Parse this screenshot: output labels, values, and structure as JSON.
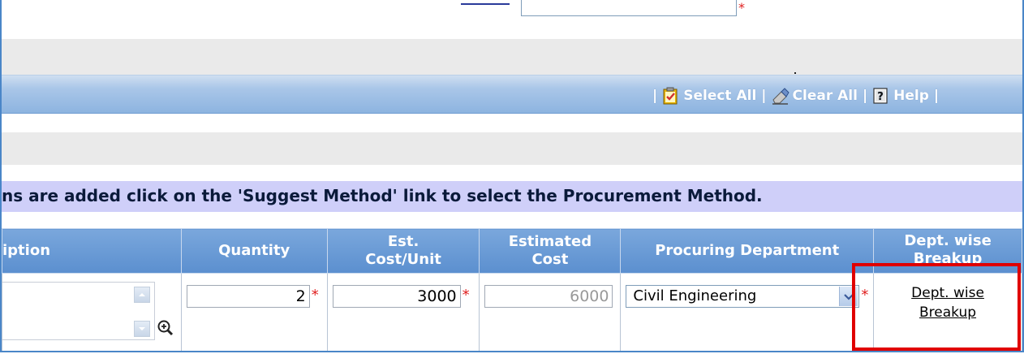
{
  "toolbar": {
    "select_all": "Select All",
    "clear_all": "Clear All",
    "help": "Help",
    "separator": "|"
  },
  "instruction": "ns are added click on the 'Suggest Method' link to select the Procurement Method.",
  "table": {
    "headers": {
      "description": "iption",
      "quantity": "Quantity",
      "est_cost_unit_line1": "Est.",
      "est_cost_unit_line2": "Cost/Unit",
      "estimated_cost_line1": "Estimated",
      "estimated_cost_line2": "Cost",
      "procuring_department": "Procuring Department",
      "dept_breakup_line1": "Dept. wise",
      "dept_breakup_line2": "Breakup"
    },
    "row": {
      "quantity": "2",
      "est_cost_unit": "3000",
      "estimated_cost": "6000",
      "procuring_department": "Civil Engineering",
      "dept_breakup_line1": "Dept. wise",
      "dept_breakup_line2": "Breakup"
    }
  },
  "required_marker": "*",
  "colors": {
    "toolbar_blue": "#8db4e0",
    "header_blue": "#5b8fcf",
    "note_lavender": "#cfcff9",
    "required_red": "#e02020",
    "highlight_red": "#e00000"
  }
}
